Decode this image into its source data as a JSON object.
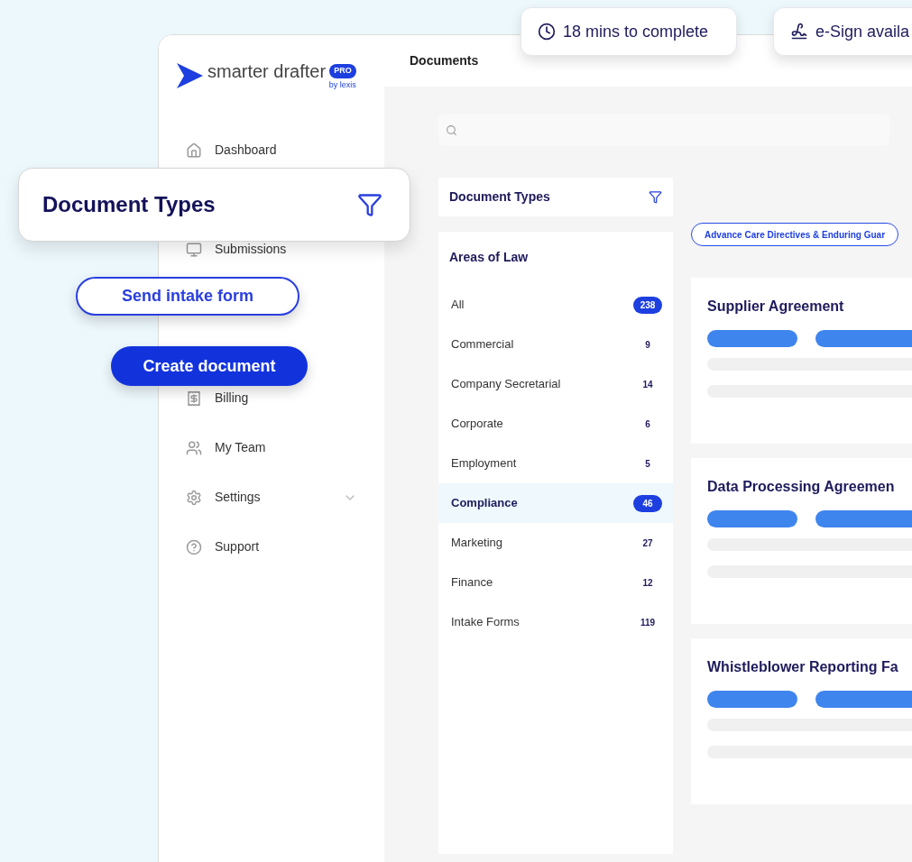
{
  "badges": [
    {
      "kind": "clock",
      "text": "18 mins to complete"
    },
    {
      "kind": "signature",
      "text": "e-Sign availa"
    }
  ],
  "brand": {
    "name": "smarter drafter",
    "tag": "PRO",
    "byline": "by lexis"
  },
  "sidebar": {
    "items": [
      {
        "label": "Dashboard",
        "has_chevron": false
      },
      {
        "label": "Submissions",
        "has_chevron": false
      },
      {
        "label": "Billing",
        "has_chevron": false
      },
      {
        "label": "My Team",
        "has_chevron": false
      },
      {
        "label": "Settings",
        "has_chevron": true
      },
      {
        "label": "Support",
        "has_chevron": false
      }
    ]
  },
  "page_title": "Documents",
  "filter_card": {
    "title": "Document Types"
  },
  "actions": [
    {
      "kind": "outline",
      "label": "Send intake form"
    },
    {
      "kind": "filled",
      "label": "Create document"
    }
  ],
  "panel": {
    "title": "Document Types",
    "section": "Areas of Law",
    "categories": [
      {
        "label": "All",
        "count": "238",
        "selected": false,
        "badge_filled": true
      },
      {
        "label": "Commercial",
        "count": "9",
        "selected": false,
        "badge_filled": false
      },
      {
        "label": "Company Secretarial",
        "count": "14",
        "selected": false,
        "badge_filled": false
      },
      {
        "label": "Corporate",
        "count": "6",
        "selected": false,
        "badge_filled": false
      },
      {
        "label": "Employment",
        "count": "5",
        "selected": false,
        "badge_filled": false
      },
      {
        "label": "Compliance",
        "count": "46",
        "selected": true,
        "badge_filled": true
      },
      {
        "label": "Marketing",
        "count": "27",
        "selected": false,
        "badge_filled": false
      },
      {
        "label": "Finance",
        "count": "12",
        "selected": false,
        "badge_filled": false
      },
      {
        "label": "Intake Forms",
        "count": "119",
        "selected": false,
        "badge_filled": false
      }
    ]
  },
  "filter_chip": "Advance Care Directives & Enduring Guar",
  "documents": [
    {
      "title": "Supplier Agreement"
    },
    {
      "title": "Data Processing Agreemen"
    },
    {
      "title": "Whistleblower Reporting Fa"
    }
  ]
}
